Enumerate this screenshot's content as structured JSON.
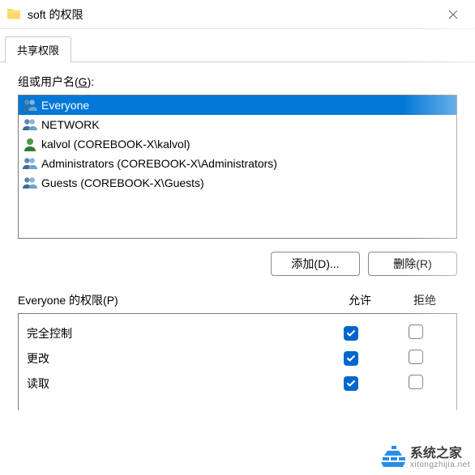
{
  "titlebar": {
    "title": "soft 的权限"
  },
  "tabs": {
    "active": "共享权限"
  },
  "labels": {
    "groups_users_prefix": "组或用户名(",
    "groups_users_key": "G",
    "groups_users_suffix": "):",
    "add_prefix": "添加(",
    "add_key": "D",
    "add_suffix": ")...",
    "remove_prefix": "删除(",
    "remove_key": "R",
    "remove_suffix": ")",
    "perm_prefix": "Everyone 的权限(",
    "perm_key": "P",
    "perm_suffix": ")",
    "allow": "允许",
    "deny": "拒绝"
  },
  "principals": [
    {
      "name": "Everyone",
      "icon": "group",
      "selected": true
    },
    {
      "name": "NETWORK",
      "icon": "group",
      "selected": false
    },
    {
      "name": "kalvol (COREBOOK-X\\kalvol)",
      "icon": "user",
      "selected": false
    },
    {
      "name": "Administrators (COREBOOK-X\\Administrators)",
      "icon": "group",
      "selected": false
    },
    {
      "name": "Guests (COREBOOK-X\\Guests)",
      "icon": "group",
      "selected": false
    }
  ],
  "permissions": [
    {
      "label": "完全控制",
      "allow": true,
      "deny": false
    },
    {
      "label": "更改",
      "allow": true,
      "deny": false
    },
    {
      "label": "读取",
      "allow": true,
      "deny": false
    }
  ],
  "watermark": {
    "text": "系统之家",
    "sub": "xitongzhijia.net"
  }
}
